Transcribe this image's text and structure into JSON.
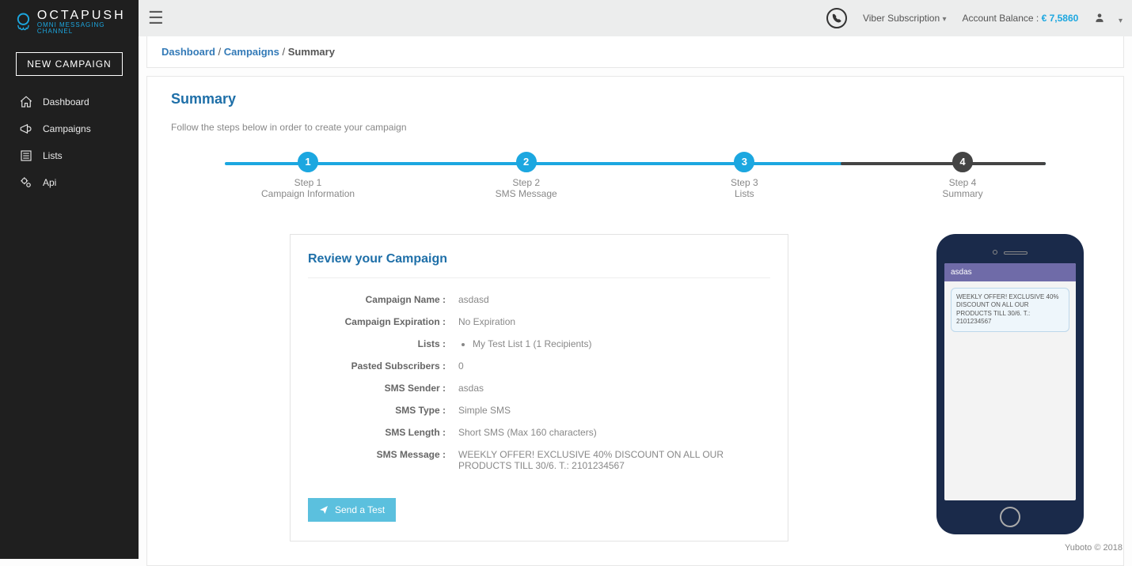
{
  "brand": {
    "name": "OCTAPUSH",
    "tagline": "OMNI MESSAGING CHANNEL"
  },
  "sidebar": {
    "new_campaign": "NEW CAMPAIGN",
    "items": [
      {
        "label": "Dashboard"
      },
      {
        "label": "Campaigns"
      },
      {
        "label": "Lists"
      },
      {
        "label": "Api"
      }
    ]
  },
  "topbar": {
    "viber_label": "Viber Subscription",
    "balance_label": "Account Balance :",
    "balance_value": "€ 7,5860"
  },
  "breadcrumb": {
    "dashboard": "Dashboard",
    "campaigns": "Campaigns",
    "current": "Summary"
  },
  "page": {
    "title": "Summary",
    "subtitle": "Follow the steps below in order to create your campaign"
  },
  "steps": [
    {
      "step": "Step 1",
      "desc": "Campaign Information",
      "num": "1"
    },
    {
      "step": "Step 2",
      "desc": "SMS Message",
      "num": "2"
    },
    {
      "step": "Step 3",
      "desc": "Lists",
      "num": "3"
    },
    {
      "step": "Step 4",
      "desc": "Summary",
      "num": "4"
    }
  ],
  "review": {
    "title": "Review your Campaign",
    "rows": {
      "campaign_name": {
        "label": "Campaign Name :",
        "value": "asdasd"
      },
      "expiration": {
        "label": "Campaign Expiration :",
        "value": "No Expiration"
      },
      "lists": {
        "label": "Lists :",
        "value": "My Test List 1 (1 Recipients)"
      },
      "pasted": {
        "label": "Pasted Subscribers :",
        "value": "0"
      },
      "sender": {
        "label": "SMS Sender :",
        "value": "asdas"
      },
      "type": {
        "label": "SMS Type :",
        "value": "Simple SMS"
      },
      "length": {
        "label": "SMS Length :",
        "value": "Short SMS (Max 160 characters)"
      },
      "message": {
        "label": "SMS Message :",
        "value": "WEEKLY OFFER! EXCLUSIVE 40% DISCOUNT ON ALL OUR PRODUCTS TILL 30/6. T.: 2101234567"
      }
    },
    "send_test": "Send a Test"
  },
  "phone": {
    "header": "asdas",
    "message": "WEEKLY OFFER! EXCLUSIVE 40% DISCOUNT ON ALL OUR PRODUCTS TILL 30/6. T.: 2101234567"
  },
  "footer": "Yuboto © 2018"
}
